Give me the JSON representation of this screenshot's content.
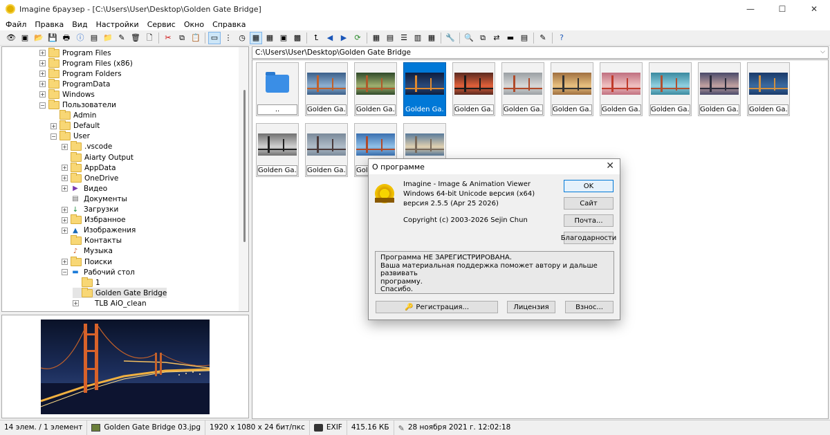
{
  "window": {
    "title": "Imagine браузер - [C:\\Users\\User\\Desktop\\Golden Gate Bridge]",
    "minimize": "—",
    "maximize": "☐",
    "close": "✕"
  },
  "menu": [
    "Файл",
    "Правка",
    "Вид",
    "Настройки",
    "Сервис",
    "Окно",
    "Справка"
  ],
  "tree": {
    "items": [
      {
        "label": "Program Files",
        "indent": 1,
        "exp": "+",
        "icon": "folder"
      },
      {
        "label": "Program Files (x86)",
        "indent": 1,
        "exp": "+",
        "icon": "folder"
      },
      {
        "label": "Program Folders",
        "indent": 1,
        "exp": "+",
        "icon": "folder"
      },
      {
        "label": "ProgramData",
        "indent": 1,
        "exp": "+",
        "icon": "folder"
      },
      {
        "label": "Windows",
        "indent": 1,
        "exp": "+",
        "icon": "folder"
      },
      {
        "label": "Пользователи",
        "indent": 1,
        "exp": "−",
        "icon": "folder"
      },
      {
        "label": "Admin",
        "indent": 2,
        "exp": "",
        "icon": "folder"
      },
      {
        "label": "Default",
        "indent": 2,
        "exp": "+",
        "icon": "folder"
      },
      {
        "label": "User",
        "indent": 2,
        "exp": "−",
        "icon": "folder"
      },
      {
        "label": ".vscode",
        "indent": 3,
        "exp": "+",
        "icon": "folder"
      },
      {
        "label": "Aiarty Output",
        "indent": 3,
        "exp": "",
        "icon": "folder"
      },
      {
        "label": "AppData",
        "indent": 3,
        "exp": "+",
        "icon": "folder"
      },
      {
        "label": "OneDrive",
        "indent": 3,
        "exp": "+",
        "icon": "folder"
      },
      {
        "label": "Видео",
        "indent": 3,
        "exp": "+",
        "icon": "video"
      },
      {
        "label": "Документы",
        "indent": 3,
        "exp": "",
        "icon": "docs"
      },
      {
        "label": "Загрузки",
        "indent": 3,
        "exp": "+",
        "icon": "download"
      },
      {
        "label": "Избранное",
        "indent": 3,
        "exp": "+",
        "icon": "folder"
      },
      {
        "label": "Изображения",
        "indent": 3,
        "exp": "+",
        "icon": "pictures"
      },
      {
        "label": "Контакты",
        "indent": 3,
        "exp": "",
        "icon": "folder"
      },
      {
        "label": "Музыка",
        "indent": 3,
        "exp": "",
        "icon": "music"
      },
      {
        "label": "Поиски",
        "indent": 3,
        "exp": "+",
        "icon": "folder"
      },
      {
        "label": "Рабочий стол",
        "indent": 3,
        "exp": "−",
        "icon": "desktop"
      },
      {
        "label": "1",
        "indent": 4,
        "exp": "",
        "icon": "folder"
      },
      {
        "label": "Golden Gate Bridge",
        "indent": 4,
        "exp": "",
        "icon": "folder",
        "selected": true
      },
      {
        "label": "TLB AiO_clean",
        "indent": 4,
        "exp": "+",
        "icon": "none"
      }
    ]
  },
  "path": "C:\\Users\\User\\Desktop\\Golden Gate Bridge",
  "thumbnails": [
    {
      "caption": "..",
      "kind": "up"
    },
    {
      "caption": "Golden Ga...",
      "kind": "photo",
      "palette": "blue"
    },
    {
      "caption": "Golden Ga...",
      "kind": "photo",
      "palette": "green"
    },
    {
      "caption": "Golden Ga...",
      "kind": "photo",
      "palette": "night",
      "selected": true
    },
    {
      "caption": "Golden Ga...",
      "kind": "photo",
      "palette": "red"
    },
    {
      "caption": "Golden Ga...",
      "kind": "photo",
      "palette": "grey"
    },
    {
      "caption": "Golden Ga...",
      "kind": "photo",
      "palette": "sunset"
    },
    {
      "caption": "Golden Ga...",
      "kind": "photo",
      "palette": "pink"
    },
    {
      "caption": "Golden Ga...",
      "kind": "photo",
      "palette": "teal"
    },
    {
      "caption": "Golden Ga...",
      "kind": "photo",
      "palette": "dusk"
    },
    {
      "caption": "Golden Ga...",
      "kind": "photo",
      "palette": "deepblue"
    },
    {
      "caption": "Golden Ga...",
      "kind": "photo",
      "palette": "bw"
    },
    {
      "caption": "Golden Ga...",
      "kind": "photo",
      "palette": "fog"
    },
    {
      "caption": "Golden Ga...",
      "kind": "photo",
      "palette": "sky"
    },
    {
      "caption": "Golden Ga...",
      "kind": "photo",
      "palette": "beach"
    }
  ],
  "dialog": {
    "title": "О программе",
    "line1": "Imagine - Image & Animation Viewer",
    "line2": "Windows 64-bit Unicode версия (x64)",
    "line3": "версия 2.5.5 (Apr 25 2026)",
    "copyright": "Copyright (c) 2003-2026 Sejin Chun",
    "ok": "OK",
    "site": "Сайт",
    "mail": "Почта...",
    "thanks": "Благодарности",
    "reg_text": [
      "Программа НЕ ЗАРЕГИСТРИРОВАНА.",
      "Ваша материальная поддержка поможет автору и дальше развивать",
      "программу.",
      "Спасибо."
    ],
    "register": "Регистрация...",
    "license": "Лицензия",
    "donate": "Взнос...",
    "logo_text": "IMAGINE"
  },
  "status": {
    "count": "14 элем. / 1 элемент",
    "filename": "Golden Gate Bridge 03.jpg",
    "dimensions": "1920 x 1080 x 24 бит/пкс",
    "exif": "EXIF",
    "size": "415.16 КБ",
    "date": "28 ноября 2021 г. 12:02:18"
  },
  "colors": {
    "selection": "#0078d7",
    "folder": "#f8d775",
    "accent_border": "#0078d7"
  }
}
